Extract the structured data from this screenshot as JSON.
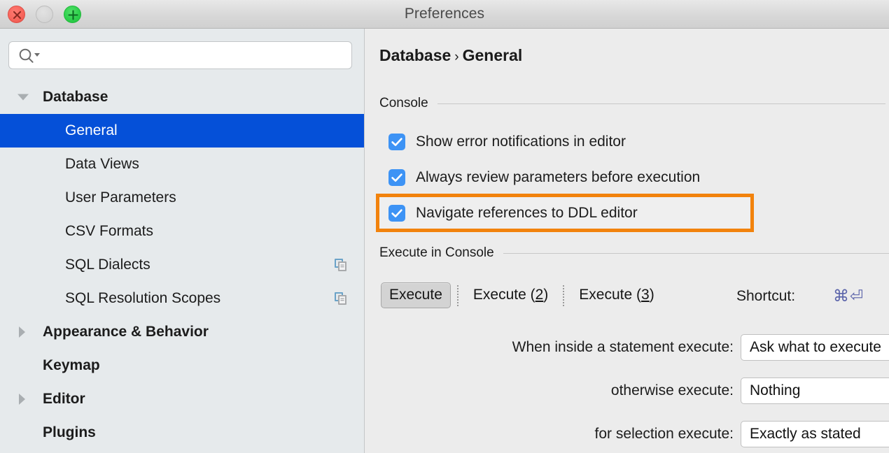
{
  "window": {
    "title": "Preferences",
    "controls": [
      {
        "name": "close",
        "label": "Close"
      },
      {
        "name": "minimize",
        "label": "Minimize"
      },
      {
        "name": "zoom",
        "label": "Zoom"
      }
    ]
  },
  "search": {
    "value": "",
    "placeholder": "",
    "icon": "search-icon"
  },
  "sidebar": {
    "items": [
      {
        "label": "Database",
        "level": 0,
        "twisty": "down",
        "selected": false,
        "copy_icon": false
      },
      {
        "label": "General",
        "level": 1,
        "twisty": "none",
        "selected": true,
        "copy_icon": false
      },
      {
        "label": "Data Views",
        "level": 1,
        "twisty": "none",
        "selected": false,
        "copy_icon": false
      },
      {
        "label": "User Parameters",
        "level": 1,
        "twisty": "none",
        "selected": false,
        "copy_icon": false
      },
      {
        "label": "CSV Formats",
        "level": 1,
        "twisty": "none",
        "selected": false,
        "copy_icon": false
      },
      {
        "label": "SQL Dialects",
        "level": 1,
        "twisty": "none",
        "selected": false,
        "copy_icon": true
      },
      {
        "label": "SQL Resolution Scopes",
        "level": 1,
        "twisty": "none",
        "selected": false,
        "copy_icon": true
      },
      {
        "label": "Appearance & Behavior",
        "level": 0,
        "twisty": "right",
        "selected": false,
        "copy_icon": false
      },
      {
        "label": "Keymap",
        "level": 0,
        "twisty": "none",
        "selected": false,
        "copy_icon": false
      },
      {
        "label": "Editor",
        "level": 0,
        "twisty": "right",
        "selected": false,
        "copy_icon": false
      },
      {
        "label": "Plugins",
        "level": 0,
        "twisty": "none",
        "selected": false,
        "copy_icon": false
      }
    ]
  },
  "breadcrumb": {
    "root": "Database",
    "separator": "›",
    "current": "General"
  },
  "console_section": {
    "title": "Console",
    "checkboxes": [
      {
        "label": "Show error notifications in editor",
        "checked": true,
        "highlighted": false
      },
      {
        "label": "Always review parameters before execution",
        "checked": true,
        "highlighted": false
      },
      {
        "label": "Navigate references to DDL editor",
        "checked": true,
        "highlighted": true
      }
    ]
  },
  "execute_section": {
    "title": "Execute in Console",
    "tabs": [
      {
        "label": "Execute",
        "mnemonic": "",
        "active": true
      },
      {
        "label": "Execute (",
        "mnemonic": "2",
        "suffix": ")",
        "active": false
      },
      {
        "label": "Execute (",
        "mnemonic": "3",
        "suffix": ")",
        "active": false
      }
    ],
    "shortcut_label": "Shortcut:",
    "shortcut_keys": "⌘⏎",
    "rows": [
      {
        "label": "When inside a statement execute:",
        "value": "Ask what to execute"
      },
      {
        "label": "otherwise execute:",
        "value": "Nothing"
      },
      {
        "label": "for selection execute:",
        "value": "Exactly as stated"
      }
    ]
  },
  "colors": {
    "selection_blue": "#0550d8",
    "checkbox_blue": "#3d93f5",
    "highlight_orange": "#f2820c",
    "shortcut_purple": "#5b64aa",
    "sidebar_bg": "#e6eaec",
    "content_bg": "#ececec"
  }
}
